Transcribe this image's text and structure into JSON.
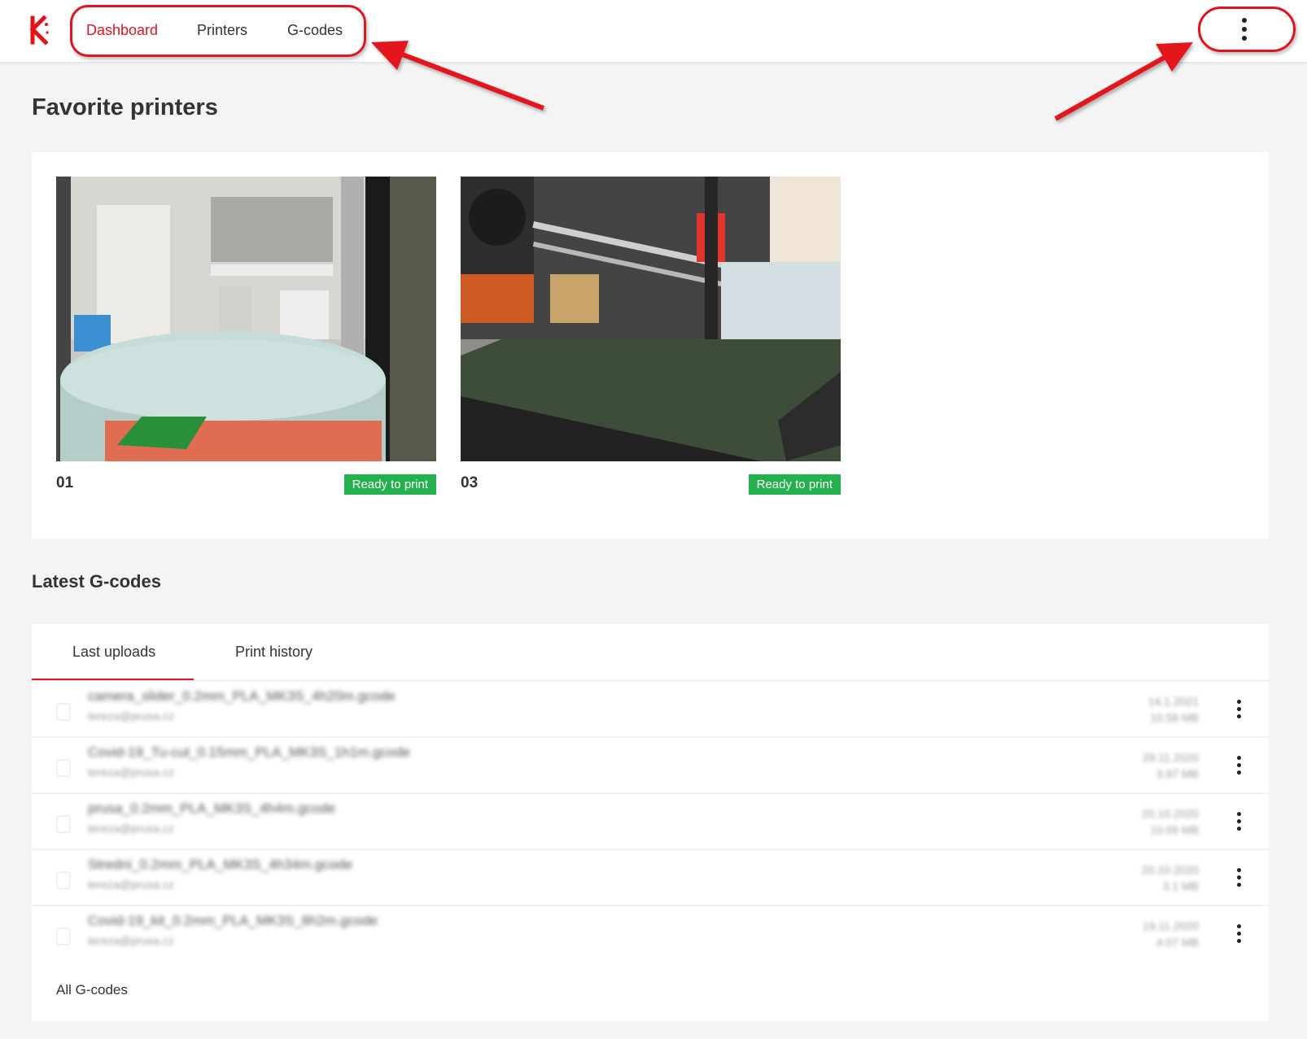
{
  "nav": {
    "items": [
      {
        "label": "Dashboard",
        "active": true
      },
      {
        "label": "Printers",
        "active": false
      },
      {
        "label": "G-codes",
        "active": false
      }
    ],
    "menu_icon": "kebab-vertical-icon",
    "logo_icon": "brand-logo-icon"
  },
  "colors": {
    "accent": "#e3121b",
    "status_ready": "#22b14c",
    "background": "#f4f4f4"
  },
  "favorites": {
    "title": "Favorite printers",
    "printers": [
      {
        "name": "01",
        "status": "Ready to print"
      },
      {
        "name": "03",
        "status": "Ready to print"
      }
    ]
  },
  "gcodes": {
    "title": "Latest G-codes",
    "tabs": [
      {
        "label": "Last uploads",
        "active": true
      },
      {
        "label": "Print history",
        "active": false
      }
    ],
    "rows": [
      {
        "name": "camera_slider_0.2mm_PLA_MK3S_4h20m.gcode",
        "owner": "tereza@prusa.cz",
        "date": "14.1.2021",
        "size": "10.58 MB"
      },
      {
        "name": "Covid-19_Tu-cut_0.15mm_PLA_MK3S_1h1m.gcode",
        "owner": "tereza@prusa.cz",
        "date": "29.11.2020",
        "size": "3.97 MB"
      },
      {
        "name": "prusa_0.2mm_PLA_MK3S_4h4m.gcode",
        "owner": "tereza@prusa.cz",
        "date": "20.10.2020",
        "size": "10.09 MB"
      },
      {
        "name": "Stredni_0.2mm_PLA_MK3S_4h34m.gcode",
        "owner": "tereza@prusa.cz",
        "date": "20.10.2020",
        "size": "3.1 MB"
      },
      {
        "name": "Covid-19_kit_0.2mm_PLA_MK3S_8h2m.gcode",
        "owner": "tereza@prusa.cz",
        "date": "19.11.2020",
        "size": "4.07 MB"
      }
    ],
    "all_link": "All G-codes"
  }
}
